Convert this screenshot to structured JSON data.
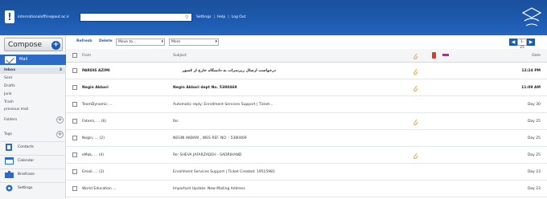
{
  "header": {
    "account": "internationaloffice@aut.ac.ir",
    "search_placeholder": "",
    "links": [
      "Settings",
      "Help",
      "Log Out"
    ]
  },
  "sidebar": {
    "compose": "Compose",
    "mail": "Mail",
    "folders": [
      {
        "label": "Inbox",
        "count": "3"
      },
      {
        "label": "Sent",
        "count": ""
      },
      {
        "label": "Drafts",
        "count": ""
      },
      {
        "label": "Junk",
        "count": ""
      },
      {
        "label": "Trash",
        "count": ""
      },
      {
        "label": "previous mail",
        "count": ""
      }
    ],
    "folders_title": "Folders",
    "tags_title": "Tags",
    "apps": [
      "Contacts",
      "Calendar",
      "Briefcase",
      "Settings"
    ]
  },
  "toolbar": {
    "refresh": "Refresh",
    "delete": "Delete",
    "move_to": "Move to...",
    "more": "More",
    "page_range": "1-25"
  },
  "columns": {
    "from": "From",
    "subject": "Subject",
    "date": "Date"
  },
  "messages": [
    {
      "from": "PARDIS AZIMI",
      "subject": "درخواست ارسال ریزنمرات به دانشگاه خارج از کشور",
      "date": "12:24 PM",
      "unread": true,
      "attach": true
    },
    {
      "from": "Negin Akbari",
      "subject": "Negin Akbari dept No. 5380469",
      "date": "11:09 AM",
      "unread": true,
      "attach": true
    },
    {
      "from": "TeamDynamic ...",
      "subject": "Automatic reply: Enrollment Services Support | Ticket...",
      "date": "Day 30",
      "unread": false,
      "attach": false
    },
    {
      "from": "Fatemi, ...  (6)",
      "subject": "Re:",
      "date": "Day 25",
      "unread": false,
      "attach": true
    },
    {
      "from": "Negin, ...  (2)",
      "subject": "NEGIN AKBARI , WES REF. NO. : 5380469",
      "date": "Day 25",
      "unread": false,
      "attach": false
    },
    {
      "from": "eMak, ...  (4)",
      "subject": "Re: SHEVA JAFARZADEH - SADRIHAND",
      "date": "Day 25",
      "unread": false,
      "attach": true
    },
    {
      "from": "Email, ...  (2)",
      "subject": "Enrollment Services Support | Ticket Created: 19515981",
      "date": "Day 23",
      "unread": false,
      "attach": false
    },
    {
      "from": "World Education ...",
      "subject": "Important Update: New Mailing Address",
      "date": "Day 23",
      "unread": false,
      "attach": false
    }
  ],
  "colors": {
    "brand": "#1d5bb0",
    "flag": "#e23a23",
    "tag": "#e0139a"
  }
}
